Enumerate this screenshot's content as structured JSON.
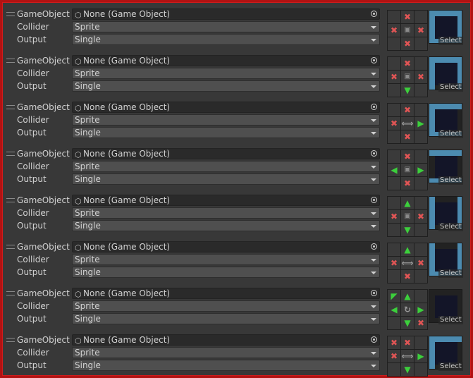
{
  "labels": {
    "game_object": "GameObject",
    "collider": "Collider",
    "output": "Output",
    "select": "Select"
  },
  "rules": [
    {
      "game_object": "None (Game Object)",
      "collider": "Sprite",
      "output": "Single",
      "neighbors": [
        "empty",
        "x",
        "empty",
        "x",
        "center",
        "x",
        "empty",
        "x",
        "empty"
      ]
    },
    {
      "game_object": "None (Game Object)",
      "collider": "Sprite",
      "output": "Single",
      "neighbors": [
        "empty",
        "x",
        "empty",
        "x",
        "center",
        "x",
        "empty",
        "arrow-down",
        "empty"
      ]
    },
    {
      "game_object": "None (Game Object)",
      "collider": "Sprite",
      "output": "Single",
      "neighbors": [
        "empty",
        "x",
        "empty",
        "x",
        "center-h",
        "arrow-right",
        "empty",
        "x",
        "empty"
      ]
    },
    {
      "game_object": "None (Game Object)",
      "collider": "Sprite",
      "output": "Single",
      "neighbors": [
        "empty",
        "x",
        "empty",
        "arrow-left",
        "center",
        "arrow-right",
        "empty",
        "x",
        "empty"
      ]
    },
    {
      "game_object": "None (Game Object)",
      "collider": "Sprite",
      "output": "Single",
      "neighbors": [
        "empty",
        "arrow-up",
        "empty",
        "x",
        "center",
        "x",
        "empty",
        "arrow-down",
        "empty"
      ]
    },
    {
      "game_object": "None (Game Object)",
      "collider": "Sprite",
      "output": "Single",
      "neighbors": [
        "empty",
        "arrow-up",
        "empty",
        "x",
        "center-h",
        "x",
        "empty",
        "x",
        "empty"
      ]
    },
    {
      "game_object": "None (Game Object)",
      "collider": "Sprite",
      "output": "Single",
      "neighbors": [
        "arrow-up-left",
        "arrow-up",
        "empty",
        "arrow-left",
        "rotate",
        "arrow-right",
        "empty",
        "arrow-down",
        "x"
      ]
    },
    {
      "game_object": "None (Game Object)",
      "collider": "Sprite",
      "output": "Single",
      "neighbors": [
        "x",
        "x",
        "empty",
        "x",
        "center-h",
        "arrow-right",
        "empty",
        "arrow-down",
        "empty"
      ]
    }
  ]
}
